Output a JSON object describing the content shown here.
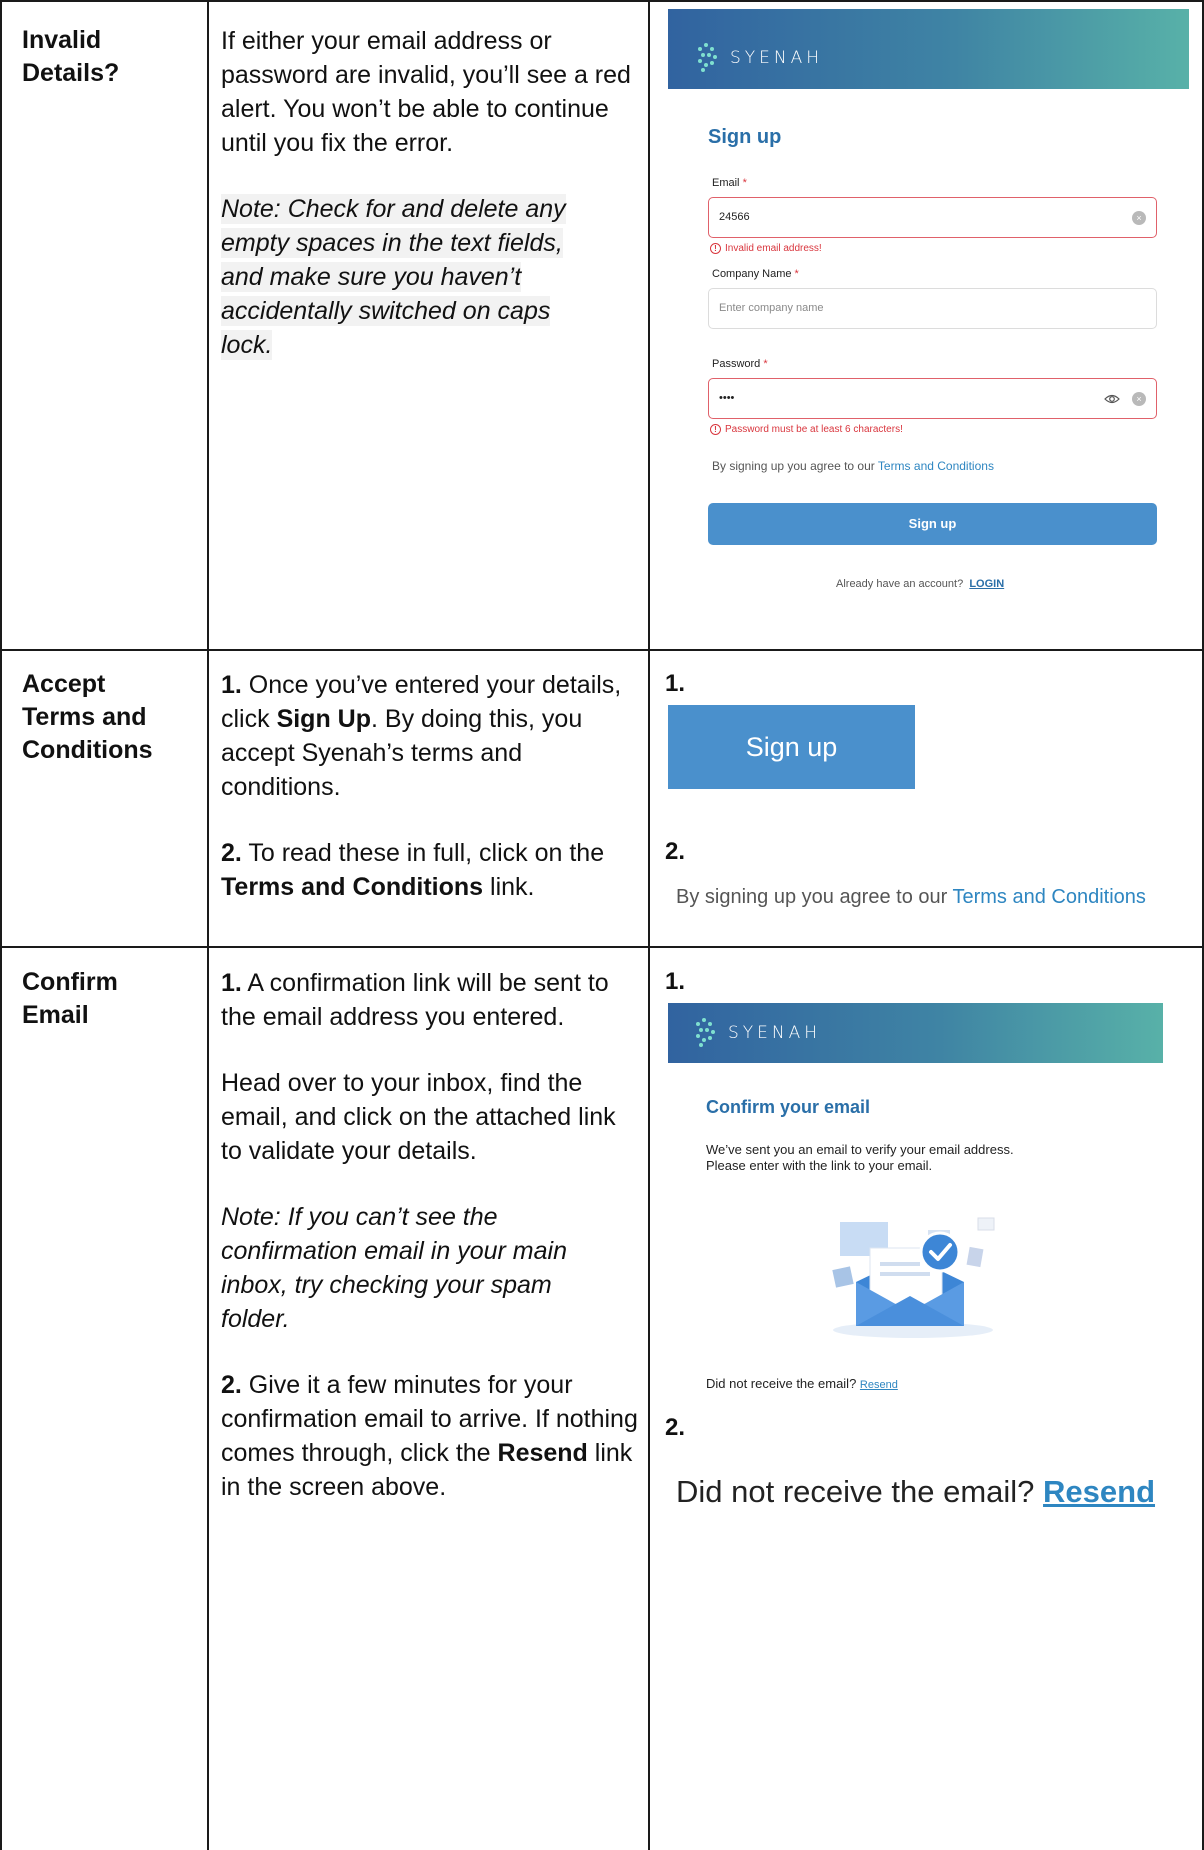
{
  "rows": [
    {
      "heading": [
        "Invalid",
        "Details?"
      ],
      "body": "If either your email address or password are invalid, you’ll see a red alert. You won’t be able to continue until you fix the error.",
      "note": "Note: Check for and delete any empty spaces in the text fields, and make sure you haven’t accidentally switched on caps lock."
    },
    {
      "heading": [
        "Accept",
        "Terms and",
        "Conditions"
      ],
      "step1": {
        "num": "1.",
        "pre": " Once you’ve entered your details, click ",
        "bold": "Sign Up",
        "post": ". By doing this, you accept Syenah’s terms and conditions."
      },
      "step2": {
        "num": "2.",
        "pre": " To read these in full, click on the ",
        "bold": "Terms and Conditions",
        "post": " link."
      }
    },
    {
      "heading": [
        "Confirm",
        "Email"
      ],
      "step1": {
        "num": "1.",
        "text": " A confirmation link will be sent to the email address you entered."
      },
      "para2": "Head over to your inbox, find the email, and click on the attached link to validate your details.",
      "note": "Note: If you can’t see the confirmation email in your main inbox, try checking your spam folder.",
      "step2": {
        "num": "2.",
        "pre": " Give it a few minutes for your confirmation email to arrive. If nothing comes through, click the ",
        "bold": "Resend",
        "post": " link in the screen above."
      }
    }
  ],
  "brand": {
    "logo_text": "SYENAH"
  },
  "signup_form": {
    "title": "Sign up",
    "email_label": "Email",
    "email_value": "24566",
    "email_error": "Invalid email address!",
    "company_label": "Company Name",
    "company_placeholder": "Enter company name",
    "password_label": "Password",
    "password_value": "••••",
    "password_error": "Password must be at least 6 characters!",
    "agree_text": "By signing up you agree to our ",
    "terms_link": "Terms and Conditions",
    "button_label": "Sign up",
    "already_text": "Already have an account?",
    "login_link": "LOGIN",
    "required_mark": "*"
  },
  "accept_panel": {
    "label1": "1.",
    "label2": "2.",
    "button_label": "Sign up",
    "agree_text": "By signing up you agree to our ",
    "terms_link": "Terms and Conditions"
  },
  "confirm_panel": {
    "label1": "1.",
    "label2": "2.",
    "title": "Confirm your email",
    "line1": "We’ve sent you an email to verify your email address.",
    "line2": "Please enter with the link to your email.",
    "not_received": "Did not receive the email? ",
    "resend_link": "Resend"
  },
  "colors": {
    "accent": "#2a6fa8",
    "button": "#4a90cc",
    "error": "#d9363e",
    "link": "#2e86c1"
  }
}
